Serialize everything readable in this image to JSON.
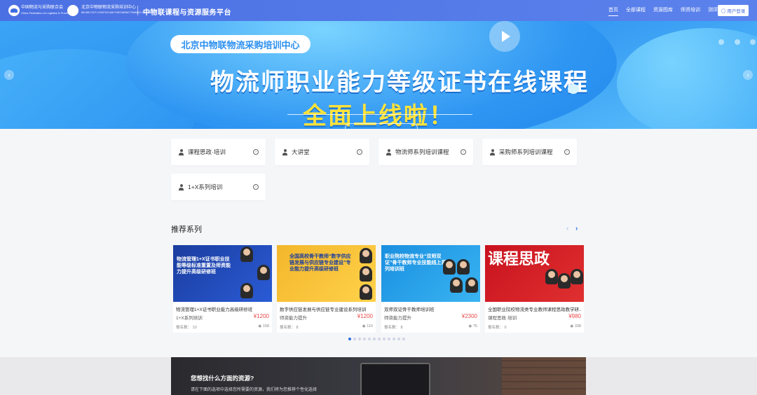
{
  "header": {
    "org_name_cn": "中国物流与采购联合会",
    "org_name_en": "China Federation of Logistics & Purchasing",
    "center_name_cn": "北京中物联物流采购培训中心",
    "center_name_en": "BEIJING CFLP LOGISTICS AND PURCHASING TRAINING CENTER",
    "platform_title": "中物联课程与资源服务平台",
    "nav": [
      "首页",
      "全部课程",
      "资源图库",
      "师资培训",
      "测评中心"
    ],
    "active_nav_index": 0,
    "user_button": "用户登录",
    "brand_color": "#4b70e3"
  },
  "banner": {
    "tag": "北京中物联物流采购培训中心",
    "headline": "物流师职业能力等级证书在线课程",
    "headline2": "全面上线啦！"
  },
  "categories": [
    {
      "label": "课程思政·培训"
    },
    {
      "label": "大讲堂"
    },
    {
      "label": "物流师系列培训课程"
    },
    {
      "label": "采购师系列培训课程"
    },
    {
      "label": "1+X系列培训"
    }
  ],
  "recommend": {
    "title": "推荐系列",
    "courses": [
      {
        "thumb_text": "物流管理1+X证书职业技能等级标准重置及师资能力提升高级研修班",
        "title": "物流管理1+X证书职业能力高级研修班",
        "category": "1+X系列培训",
        "price": "¥1200",
        "enroll_label": "报名数：",
        "enroll": "10",
        "views": "158"
      },
      {
        "thumb_text": "全国高校骨干教师“数字供应链发展与供应链专业建设”专业能力提升高级研修班",
        "title": "数字供应链发展与供应链专业建设系列培训",
        "category": "师资能力提升",
        "price": "¥1200",
        "enroll_label": "报名数：",
        "enroll": "8",
        "views": "110"
      },
      {
        "thumb_text": "职业院校物流专业“双师双证”骨干教师专业技能线上系列培训班",
        "title": "双师双证骨干教师培训班",
        "category": "师资能力提升",
        "price": "¥2300",
        "enroll_label": "报名数：",
        "enroll": "8",
        "views": "75"
      },
      {
        "thumb_text": "课程思政",
        "title": "全国职业院校物流类专业教师课程思政教学研...",
        "category": "课程思政·培训",
        "price": "¥980",
        "enroll_label": "报名数：",
        "enroll": "0",
        "views": "338"
      }
    ]
  },
  "promo": {
    "title": "您想找什么方面的资源?",
    "subtitle": "请在下面的选项中选择您所需要的资源，我们将为您推荐个性化选择"
  }
}
